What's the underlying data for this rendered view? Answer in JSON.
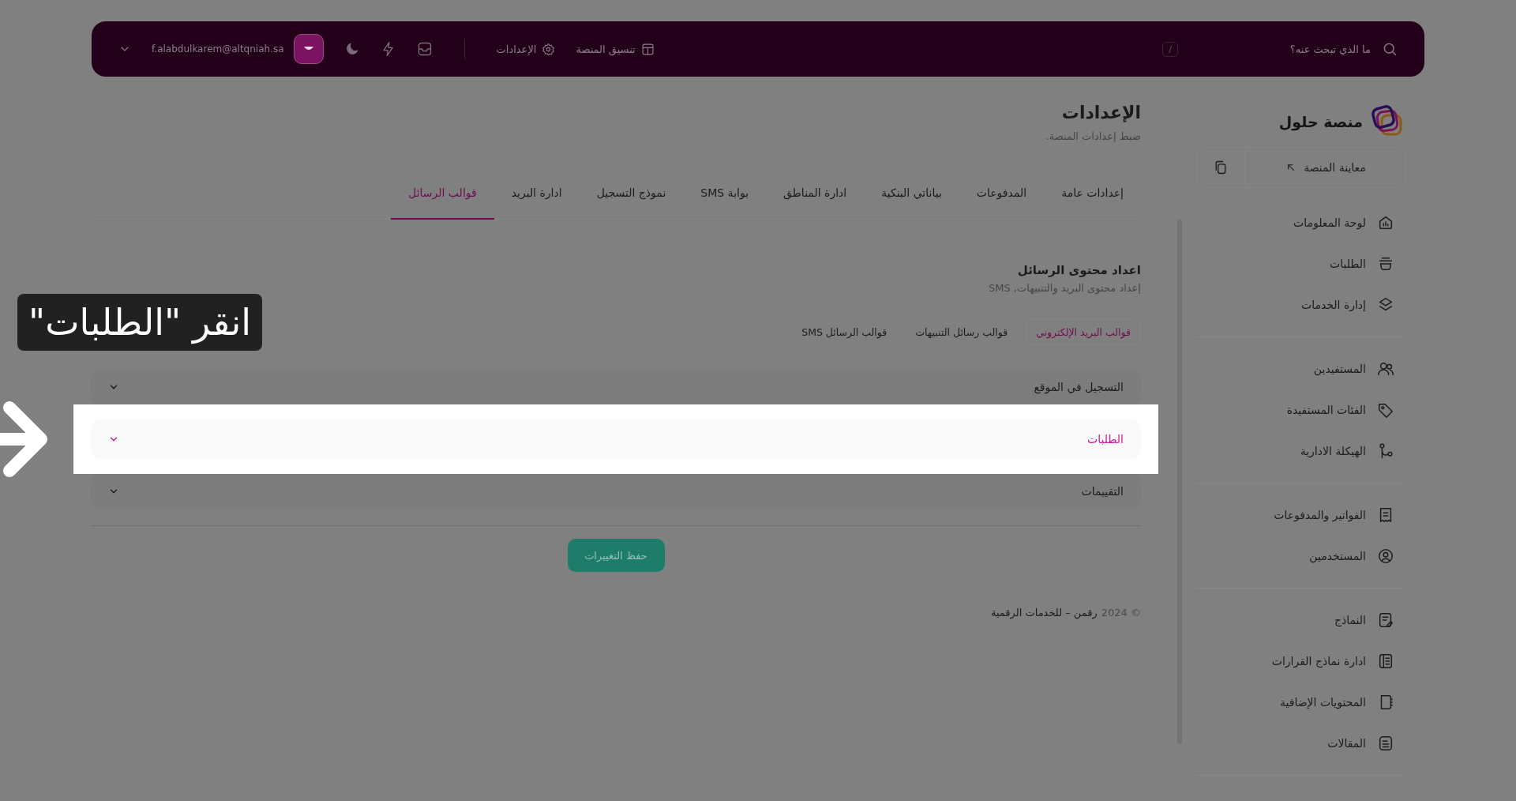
{
  "topbar": {
    "search": {
      "placeholder": "ما الذي تبحث عنه؟",
      "shortcut": "/"
    },
    "links": [
      {
        "label": "تنسيق المنصة",
        "kind": "layout"
      },
      {
        "label": "الإعدادات",
        "kind": "settings"
      }
    ],
    "user": {
      "email": "f.alabdulkarem@altqniah.sa"
    }
  },
  "sidebar": {
    "brand": "منصة حلول",
    "preview": "معاينة المنصة",
    "groups": [
      {
        "items": [
          {
            "label": "لوحة المعلومات",
            "kind": "dashboard"
          },
          {
            "label": "الطلبات",
            "kind": "orders"
          },
          {
            "label": "إدارة الخدمات",
            "kind": "services"
          }
        ]
      },
      {
        "items": [
          {
            "label": "المستفيدين",
            "kind": "users"
          },
          {
            "label": "الفئات المستفيدة",
            "kind": "tag"
          },
          {
            "label": "الهيكلة الادارية",
            "kind": "structure"
          }
        ]
      },
      {
        "items": [
          {
            "label": "الفواتير والمدفوعات",
            "kind": "invoice"
          },
          {
            "label": "المستخدمين",
            "kind": "user"
          }
        ]
      },
      {
        "items": [
          {
            "label": "النماذج",
            "kind": "form"
          },
          {
            "label": "ادارة نماذج القرارات",
            "kind": "book"
          },
          {
            "label": "المحتويات الإضافية",
            "kind": "notebook"
          },
          {
            "label": "المقالات",
            "kind": "article"
          }
        ]
      }
    ]
  },
  "page": {
    "title": "الإعدادات",
    "subtitle": "ضبط إعدادات المنصة."
  },
  "tabs": [
    {
      "label": "إعدادات عامة",
      "selected": false
    },
    {
      "label": "المدفوعات",
      "selected": false
    },
    {
      "label": "بياناتي البنكية",
      "selected": false
    },
    {
      "label": "ادارة المناطق",
      "selected": false
    },
    {
      "label": "بوابة SMS",
      "selected": false
    },
    {
      "label": "نموذج التسجيل",
      "selected": false
    },
    {
      "label": "ادارة البريد",
      "selected": false
    },
    {
      "label": "قوالب الرسائل",
      "selected": true
    }
  ],
  "section": {
    "title": "اعداد محتوى الرسائل",
    "subtitle": "إعداد محتوى البريد والتنبيهات, SMS"
  },
  "subtabs": [
    {
      "label": "قوالب البريد الإلكتروني",
      "selected": true
    },
    {
      "label": "قوالب رسائل التنبيهات",
      "selected": false
    },
    {
      "label": "قوالب الرسائل SMS",
      "selected": false
    }
  ],
  "templates": [
    {
      "label": "التسجيل في الموقع",
      "highlighted": false
    },
    {
      "label": "الطلبات",
      "highlighted": true
    },
    {
      "label": "التقييمات",
      "highlighted": false
    }
  ],
  "save_button": "حفظ التغييرات",
  "footer": {
    "copyright": "© 2024",
    "text": "رقمن – للخدمات الرقمية"
  },
  "tooltip": {
    "text": "انقر \"الطلبات\""
  }
}
